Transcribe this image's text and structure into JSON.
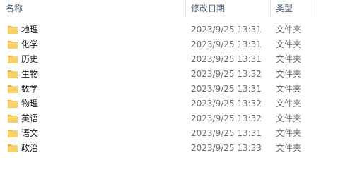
{
  "columns": {
    "name": "名称",
    "date_modified": "修改日期",
    "type": "类型"
  },
  "sort_indicator": "^",
  "icons": {
    "folder": "folder-icon"
  },
  "colors": {
    "folder_yellow": "#f5c542",
    "header_text": "#4c607a",
    "detail_text": "#6d6d6d"
  },
  "files": [
    {
      "name": "地理",
      "date": "2023/9/25 13:31",
      "type": "文件夹"
    },
    {
      "name": "化学",
      "date": "2023/9/25 13:31",
      "type": "文件夹"
    },
    {
      "name": "历史",
      "date": "2023/9/25 13:31",
      "type": "文件夹"
    },
    {
      "name": "生物",
      "date": "2023/9/25 13:32",
      "type": "文件夹"
    },
    {
      "name": "数学",
      "date": "2023/9/25 13:31",
      "type": "文件夹"
    },
    {
      "name": "物理",
      "date": "2023/9/25 13:32",
      "type": "文件夹"
    },
    {
      "name": "英语",
      "date": "2023/9/25 13:32",
      "type": "文件夹"
    },
    {
      "name": "语文",
      "date": "2023/9/25 13:31",
      "type": "文件夹"
    },
    {
      "name": "政治",
      "date": "2023/9/25 13:33",
      "type": "文件夹"
    }
  ]
}
